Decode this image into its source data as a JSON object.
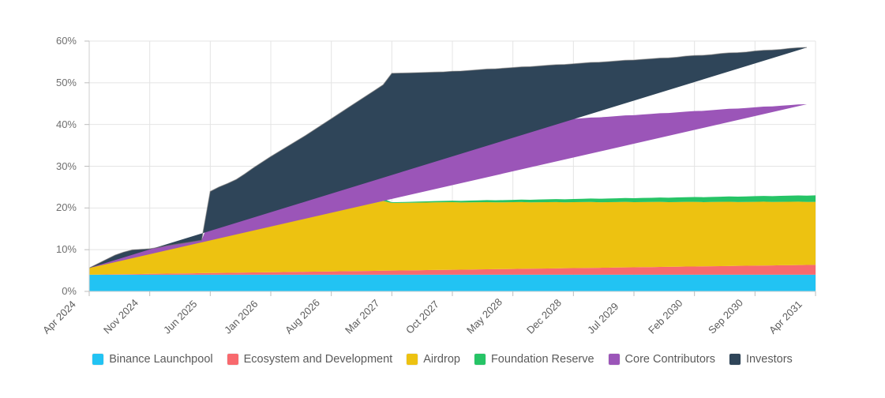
{
  "chart_data": {
    "type": "area",
    "stacked": true,
    "title": "",
    "subtitle": "",
    "xlabel": "",
    "ylabel": "",
    "ylim": [
      0,
      60
    ],
    "yticks": [
      0,
      10,
      20,
      30,
      40,
      50,
      60
    ],
    "ytick_labels": [
      "0%",
      "10%",
      "20%",
      "30%",
      "40%",
      "50%",
      "60%"
    ],
    "grid": true,
    "legend_position": "bottom",
    "x_tick_labels": [
      "Apr 2024",
      "Nov 2024",
      "Jun 2025",
      "Jan 2026",
      "Aug 2026",
      "Mar 2027",
      "Oct 2027",
      "May 2028",
      "Dec 2028",
      "Jul 2029",
      "Feb 2030",
      "Sep 2030",
      "Apr 2031"
    ],
    "x_index": [
      0,
      7,
      14,
      21,
      28,
      35,
      42,
      49,
      56,
      63,
      70,
      77,
      84
    ],
    "x_months": [
      "Apr 2024",
      "May 2024",
      "Jun 2024",
      "Jul 2024",
      "Aug 2024",
      "Sep 2024",
      "Oct 2024",
      "Nov 2024",
      "Dec 2024",
      "Jan 2025",
      "Feb 2025",
      "Mar 2025",
      "Apr 2025",
      "May 2025",
      "Jun 2025",
      "Jul 2025",
      "Aug 2025",
      "Sep 2025",
      "Oct 2025",
      "Nov 2025",
      "Dec 2025",
      "Jan 2026",
      "Feb 2026",
      "Mar 2026",
      "Apr 2026",
      "May 2026",
      "Jun 2026",
      "Jul 2026",
      "Aug 2026",
      "Sep 2026",
      "Oct 2026",
      "Nov 2026",
      "Dec 2026",
      "Jan 2027",
      "Feb 2027",
      "Mar 2027",
      "Apr 2027",
      "May 2027",
      "Jun 2027",
      "Jul 2027",
      "Aug 2027",
      "Sep 2027",
      "Oct 2027",
      "Nov 2027",
      "Dec 2027",
      "Jan 2028",
      "Feb 2028",
      "Mar 2028",
      "Apr 2028",
      "May 2028",
      "Jun 2028",
      "Jul 2028",
      "Aug 2028",
      "Sep 2028",
      "Oct 2028",
      "Nov 2028",
      "Dec 2028",
      "Jan 2029",
      "Feb 2029",
      "Mar 2029",
      "Apr 2029",
      "May 2029",
      "Jun 2029",
      "Jul 2029",
      "Aug 2029",
      "Sep 2029",
      "Oct 2029",
      "Nov 2029",
      "Dec 2029",
      "Jan 2030",
      "Feb 2030",
      "Mar 2030",
      "Apr 2030",
      "May 2030",
      "Jun 2030",
      "Jul 2030",
      "Aug 2030",
      "Sep 2030",
      "Oct 2030",
      "Nov 2030",
      "Dec 2030",
      "Jan 2031",
      "Feb 2031",
      "Mar 2031",
      "Apr 2031"
    ],
    "series": [
      {
        "name": "Binance Launchpool",
        "color": "#22c3f3",
        "values": [
          4.0,
          4.0,
          4.0,
          4.0,
          4.0,
          4.0,
          4.0,
          4.0,
          4.0,
          4.0,
          4.0,
          4.0,
          4.0,
          4.0,
          4.0,
          4.0,
          4.0,
          4.0,
          4.0,
          4.0,
          4.0,
          4.0,
          4.0,
          4.0,
          4.0,
          4.0,
          4.0,
          4.0,
          4.0,
          4.0,
          4.0,
          4.0,
          4.0,
          4.0,
          4.0,
          4.0,
          4.0,
          4.0,
          4.0,
          4.0,
          4.0,
          4.0,
          4.0,
          4.0,
          4.0,
          4.0,
          4.0,
          4.0,
          4.0,
          4.0,
          4.0,
          4.0,
          4.0,
          4.0,
          4.0,
          4.0,
          4.0,
          4.0,
          4.0,
          4.0,
          4.0,
          4.0,
          4.0,
          4.0,
          4.0,
          4.0,
          4.0,
          4.0,
          4.0,
          4.0,
          4.0,
          4.0,
          4.0,
          4.0,
          4.0,
          4.0,
          4.0,
          4.0,
          4.0,
          4.0,
          4.0,
          4.0,
          4.0,
          4.0,
          4.0
        ]
      },
      {
        "name": "Ecosystem and Development",
        "color": "#f8696e",
        "values": [
          0.0,
          0.03,
          0.06,
          0.09,
          0.11,
          0.14,
          0.17,
          0.2,
          0.23,
          0.25,
          0.28,
          0.31,
          0.34,
          0.37,
          0.4,
          0.42,
          0.45,
          0.48,
          0.51,
          0.54,
          0.57,
          0.59,
          0.62,
          0.65,
          0.68,
          0.71,
          0.73,
          0.76,
          0.79,
          0.82,
          0.85,
          0.88,
          0.9,
          0.93,
          0.96,
          0.99,
          1.02,
          1.04,
          1.07,
          1.1,
          1.13,
          1.16,
          1.19,
          1.21,
          1.24,
          1.27,
          1.3,
          1.33,
          1.35,
          1.38,
          1.41,
          1.44,
          1.47,
          1.5,
          1.52,
          1.55,
          1.58,
          1.61,
          1.64,
          1.66,
          1.69,
          1.72,
          1.75,
          1.78,
          1.81,
          1.83,
          1.86,
          1.89,
          1.92,
          1.95,
          1.97,
          2.0,
          2.03,
          2.06,
          2.09,
          2.12,
          2.14,
          2.17,
          2.2,
          2.23,
          2.26,
          2.28,
          2.31,
          2.34,
          2.37
        ]
      },
      {
        "name": "Airdrop",
        "color": "#edc211",
        "values": [
          1.6,
          2.6,
          3.6,
          4.6,
          5.3,
          5.8,
          5.9,
          6.0,
          6.3,
          6.7,
          7.0,
          7.3,
          7.6,
          7.9,
          8.2,
          8.6,
          9.2,
          9.8,
          10.4,
          10.9,
          11.3,
          11.7,
          12.0,
          12.3,
          12.7,
          13.1,
          13.5,
          13.9,
          14.3,
          14.7,
          15.1,
          15.5,
          15.9,
          16.3,
          16.7,
          16.2,
          16.2,
          16.2,
          16.2,
          16.2,
          16.2,
          16.2,
          16.2,
          16.1,
          16.1,
          16.1,
          16.1,
          16.0,
          16.0,
          16.0,
          16.0,
          15.9,
          15.9,
          15.9,
          15.9,
          15.8,
          15.8,
          15.8,
          15.8,
          15.7,
          15.7,
          15.7,
          15.7,
          15.6,
          15.6,
          15.6,
          15.6,
          15.5,
          15.5,
          15.5,
          15.5,
          15.4,
          15.4,
          15.4,
          15.4,
          15.3,
          15.3,
          15.3,
          15.3,
          15.2,
          15.2,
          15.2,
          15.2,
          15.1,
          15.1
        ]
      },
      {
        "name": "Foundation Reserve",
        "color": "#26c466",
        "values": [
          0.0,
          0.0,
          0.0,
          0.0,
          0.0,
          0.0,
          0.0,
          0.0,
          0.0,
          0.0,
          0.0,
          0.0,
          0.0,
          0.0,
          0.05,
          0.08,
          0.1,
          0.13,
          0.15,
          0.18,
          0.2,
          0.22,
          0.25,
          0.27,
          0.3,
          0.32,
          0.35,
          0.37,
          0.4,
          0.42,
          0.45,
          0.47,
          0.5,
          0.52,
          0.55,
          0.17,
          0.2,
          0.22,
          0.25,
          0.28,
          0.31,
          0.34,
          0.36,
          0.39,
          0.42,
          0.45,
          0.48,
          0.51,
          0.54,
          0.56,
          0.59,
          0.62,
          0.65,
          0.68,
          0.7,
          0.73,
          0.76,
          0.79,
          0.82,
          0.85,
          0.87,
          0.9,
          0.93,
          0.96,
          0.99,
          1.01,
          1.04,
          1.07,
          1.1,
          1.13,
          1.16,
          1.18,
          1.21,
          1.24,
          1.27,
          1.3,
          1.32,
          1.35,
          1.38,
          1.41,
          1.44,
          1.46,
          1.49,
          1.52,
          1.55
        ]
      },
      {
        "name": "Core Contributors",
        "color": "#9b55b8",
        "values": [
          0.0,
          0.0,
          0.0,
          0.0,
          0.0,
          0.0,
          0.0,
          0.0,
          0.0,
          0.0,
          0.0,
          0.0,
          0.0,
          0.0,
          4.8,
          5.0,
          5.1,
          5.3,
          5.7,
          6.2,
          6.7,
          7.2,
          7.7,
          8.2,
          8.7,
          9.2,
          9.8,
          10.4,
          11.0,
          11.6,
          12.2,
          12.8,
          13.4,
          14.0,
          14.6,
          17.7,
          17.7,
          17.7,
          17.7,
          17.7,
          17.7,
          17.7,
          17.8,
          17.9,
          18.0,
          18.1,
          18.2,
          18.3,
          18.4,
          18.5,
          18.6,
          18.7,
          18.8,
          18.9,
          19.0,
          19.1,
          19.2,
          19.3,
          19.4,
          19.5,
          19.6,
          19.7,
          19.8,
          19.9,
          20.0,
          20.1,
          20.2,
          20.3,
          20.4,
          20.5,
          20.6,
          20.7,
          20.8,
          20.9,
          21.0,
          21.1,
          21.2,
          21.3,
          21.4,
          21.5,
          21.6,
          21.7,
          21.8,
          21.9
        ]
      },
      {
        "name": "Investors",
        "color": "#2f4559",
        "values": [
          0.0,
          0.0,
          0.0,
          0.0,
          0.0,
          0.0,
          0.0,
          0.0,
          0.0,
          0.0,
          0.0,
          0.0,
          0.0,
          0.0,
          6.5,
          6.9,
          7.0,
          7.1,
          7.4,
          7.8,
          8.2,
          8.6,
          9.0,
          9.4,
          9.7,
          10.0,
          10.3,
          10.6,
          10.9,
          11.2,
          11.5,
          11.8,
          12.1,
          12.4,
          12.7,
          13.2,
          13.2,
          13.2,
          13.2,
          13.2,
          13.2,
          13.2,
          13.2,
          13.2,
          13.2,
          13.2,
          13.2,
          13.2,
          13.2,
          13.2,
          13.2,
          13.2,
          13.2,
          13.2,
          13.2,
          13.2,
          13.2,
          13.2,
          13.2,
          13.2,
          13.2,
          13.2,
          13.2,
          13.2,
          13.2,
          13.2,
          13.2,
          13.2,
          13.2,
          13.3,
          13.3,
          13.3,
          13.3,
          13.4,
          13.4,
          13.4,
          13.4,
          13.5,
          13.5,
          13.5,
          13.5,
          13.6,
          13.6,
          13.6
        ]
      }
    ],
    "totals_key_points": {
      "Apr 2024": 5.6,
      "Nov 2024": 10.2,
      "Jun 2025": 24.9,
      "Jan 2026": 31.8,
      "Aug 2026": 38.4,
      "Mar 2027": 54.0,
      "Oct 2027": 54.6,
      "Apr 2031": 56.6
    }
  },
  "axis": {
    "y_labels": [
      "60%",
      "50%",
      "40%",
      "30%",
      "20%",
      "10%",
      "0%"
    ],
    "x_labels": [
      "Apr 2024",
      "Nov 2024",
      "Jun 2025",
      "Jan 2026",
      "Aug 2026",
      "Mar 2027",
      "Oct 2027",
      "May 2028",
      "Dec 2028",
      "Jul 2029",
      "Feb 2030",
      "Sep 2030",
      "Apr 2031"
    ]
  },
  "legend": {
    "items": [
      {
        "label": "Binance Launchpool",
        "color": "#22c3f3"
      },
      {
        "label": "Ecosystem and Development",
        "color": "#f8696e"
      },
      {
        "label": "Airdrop",
        "color": "#edc211"
      },
      {
        "label": "Foundation Reserve",
        "color": "#26c466"
      },
      {
        "label": "Core Contributors",
        "color": "#9b55b8"
      },
      {
        "label": "Investors",
        "color": "#2f4559"
      }
    ]
  },
  "colors": {
    "grid": "#e4e4e4",
    "axis_text": "#6f6f6f",
    "background": "#ffffff",
    "area_stroke": "#6b6b6b"
  }
}
